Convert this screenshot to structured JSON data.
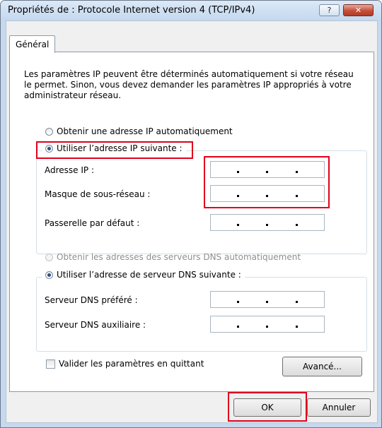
{
  "window": {
    "title": "Propriétés de : Protocole Internet version 4 (TCP/IPv4)",
    "help_label": "?",
    "close_label": "✕"
  },
  "tabs": [
    {
      "label": "Général",
      "selected": true
    }
  ],
  "intro_text": "Les paramètres IP peuvent être déterminés automatiquement si votre réseau le permet. Sinon, vous devez demander les paramètres IP appropriés à votre administrateur réseau.",
  "ip_section": {
    "auto_option": {
      "label": "Obtenir une adresse IP automatiquement",
      "checked": false
    },
    "manual_option": {
      "label": "Utiliser l’adresse IP suivante :",
      "checked": true
    },
    "fields": [
      {
        "label": "Adresse IP :",
        "value": ""
      },
      {
        "label": "Masque de sous-réseau :",
        "value": ""
      },
      {
        "label": "Passerelle par défaut :",
        "value": ""
      }
    ]
  },
  "dns_section": {
    "auto_option": {
      "label": "Obtenir les adresses des serveurs DNS automatiquement",
      "checked": false,
      "disabled": true
    },
    "manual_option": {
      "label": "Utiliser l’adresse de serveur DNS suivante :",
      "checked": true
    },
    "fields": [
      {
        "label": "Serveur DNS préféré :",
        "value": ""
      },
      {
        "label": "Serveur DNS auxiliaire :",
        "value": ""
      }
    ]
  },
  "validate_checkbox": {
    "label": "Valider les paramètres en quittant",
    "checked": false
  },
  "buttons": {
    "advanced": "Avancé...",
    "ok": "OK",
    "cancel": "Annuler"
  },
  "highlight_color": "#e0001b"
}
